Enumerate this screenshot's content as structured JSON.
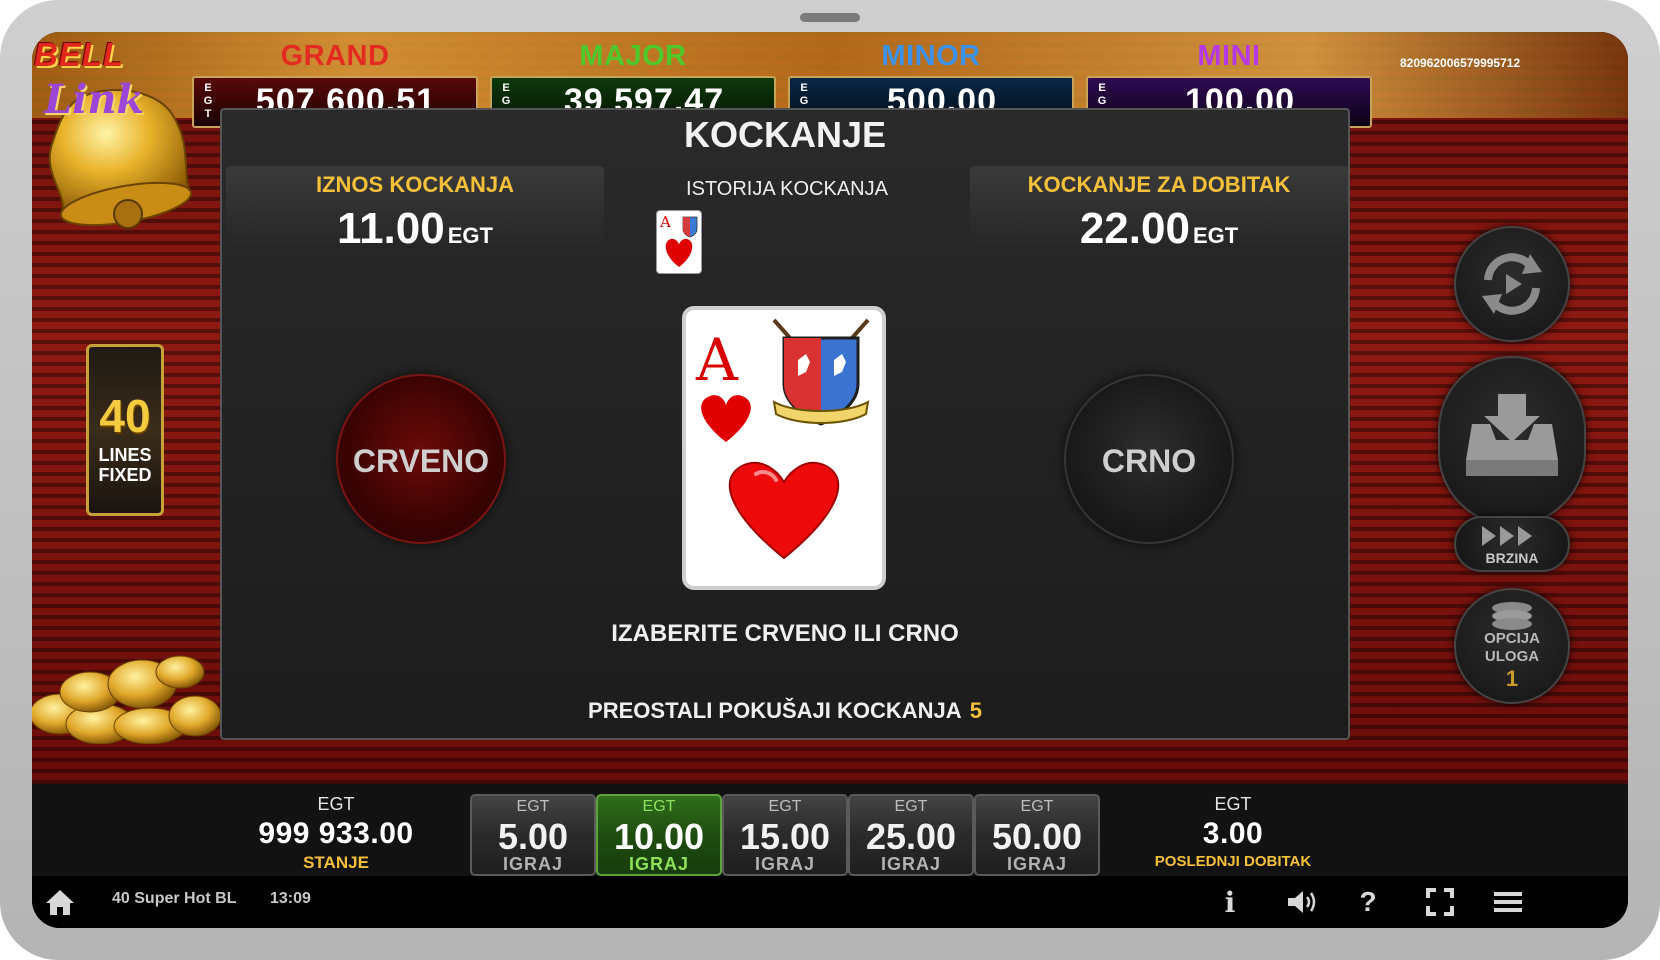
{
  "jackpots": [
    {
      "name": "GRAND",
      "currency_vertical": "E\nG\nT",
      "value": "507 600.51",
      "title_color": "#e32b22",
      "bg": "#5a0808"
    },
    {
      "name": "MAJOR",
      "currency_vertical": "E\nG\nT",
      "value": "39 597.47",
      "title_color": "#4ec82a",
      "bg": "#0d3a0a"
    },
    {
      "name": "MINOR",
      "currency_vertical": "E\nG\nT",
      "value": "500.00",
      "title_color": "#3c92ea",
      "bg": "#082747"
    },
    {
      "name": "MINI",
      "currency_vertical": "E\nG\nT",
      "value": "100.00",
      "title_color": "#b63ae4",
      "bg": "#2e0a52"
    }
  ],
  "ticket_id": "820962006579995712",
  "logo": {
    "line1": "BELL",
    "line2": "Link"
  },
  "lines_badge": {
    "number": "40",
    "line1": "LINES",
    "line2": "FIXED"
  },
  "gamble": {
    "title": "KOCKANJE",
    "stake": {
      "label": "IZNOS KOCKANJA",
      "value": "11.00",
      "currency": "EGT"
    },
    "history": {
      "label": "ISTORIJA KOCKANJA",
      "cards": [
        {
          "rank": "A",
          "suit": "hearts"
        }
      ]
    },
    "win_to": {
      "label": "KOCKANJE ZA DOBITAK",
      "value": "22.00",
      "currency": "EGT"
    },
    "red_button": "CRVENO",
    "black_button": "CRNO",
    "current_card": {
      "rank": "A",
      "suit": "hearts"
    },
    "instruction": "IZABERITE CRVENO ILI CRNO",
    "attempts_label": "PREOSTALI POKUŠAJI KOCKANJA",
    "attempts_value": "5"
  },
  "right_controls": {
    "speed_label": "BRZINA",
    "stake_option_line1": "OPCIJA",
    "stake_option_line2": "ULOGA",
    "stake_option_value": "1"
  },
  "bottom": {
    "balance": {
      "currency": "EGT",
      "value": "999 933.00",
      "label": "STANJE"
    },
    "bets": [
      {
        "currency": "EGT",
        "value": "5.00",
        "label": "IGRAJ",
        "selected": false
      },
      {
        "currency": "EGT",
        "value": "10.00",
        "label": "IGRAJ",
        "selected": true
      },
      {
        "currency": "EGT",
        "value": "15.00",
        "label": "IGRAJ",
        "selected": false
      },
      {
        "currency": "EGT",
        "value": "25.00",
        "label": "IGRAJ",
        "selected": false
      },
      {
        "currency": "EGT",
        "value": "50.00",
        "label": "IGRAJ",
        "selected": false
      }
    ],
    "last_win": {
      "currency": "EGT",
      "value": "3.00",
      "label": "POSLEDNJI DOBITAK"
    }
  },
  "status_bar": {
    "game_name": "40 Super Hot BL",
    "time": "13:09",
    "icons": [
      "home-icon",
      "info-icon",
      "sound-icon",
      "help-icon",
      "fullscreen-icon",
      "menu-icon"
    ],
    "info_glyph": "i",
    "help_glyph": "?"
  },
  "colors": {
    "accent_gold": "#f5c03a",
    "selected_bet": "#2f6e1b"
  }
}
